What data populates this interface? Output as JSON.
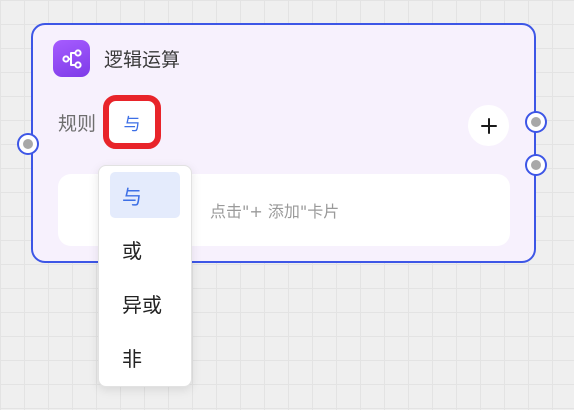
{
  "node": {
    "title": "逻辑运算",
    "icon": "flow-branch-icon",
    "border_color": "#3d56e6",
    "icon_color": "#8a45f0"
  },
  "rule": {
    "label": "规则",
    "selected_operator": "与",
    "highlight_color": "#e8242a"
  },
  "add_button": {
    "icon": "plus-icon"
  },
  "card_area": {
    "hint": "点击\"+ 添加\"卡片"
  },
  "dropdown": {
    "items": [
      {
        "label": "与",
        "selected": true
      },
      {
        "label": "或",
        "selected": false
      },
      {
        "label": "异或",
        "selected": false
      },
      {
        "label": "非",
        "selected": false
      }
    ]
  }
}
